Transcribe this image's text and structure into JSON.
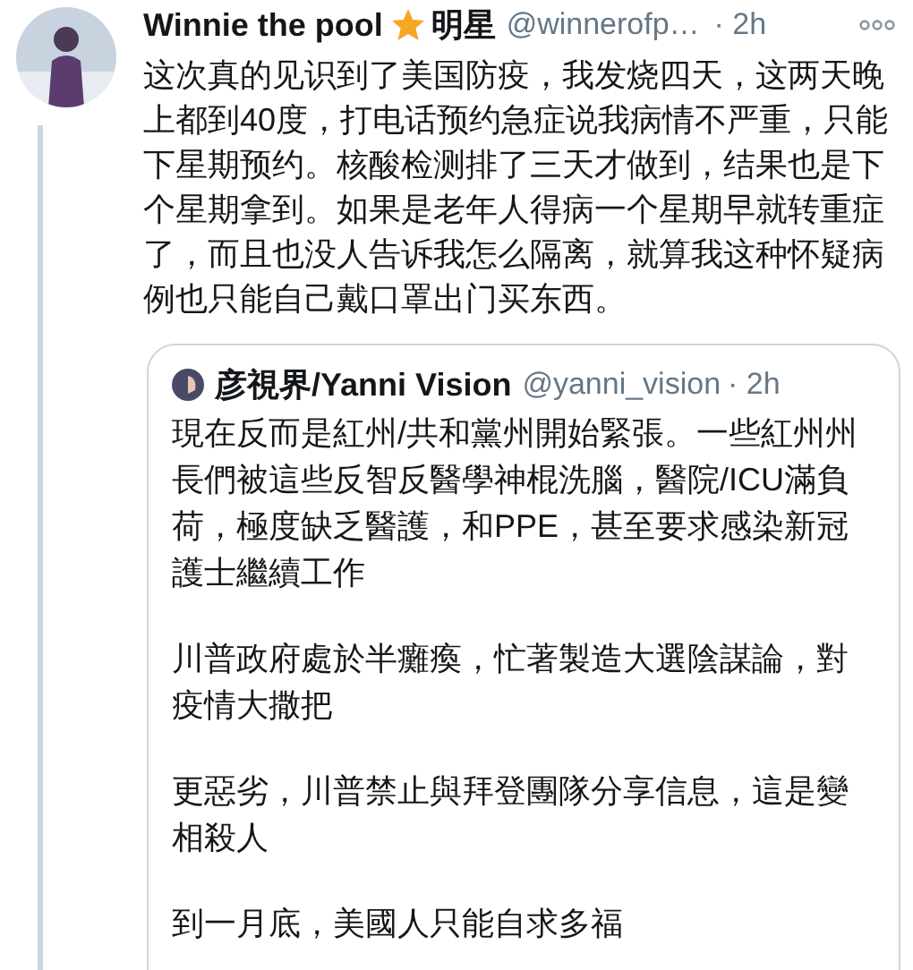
{
  "tweet": {
    "author": {
      "name": "Winnie the pool",
      "badge_label": "明星",
      "handle": "@winnerofp…",
      "time": "· 2h"
    },
    "text": "这次真的见识到了美国防疫，我发烧四天，这两天晚上都到40度，打电话预约急症说我病情不严重，只能下星期预约。核酸检测排了三天才做到，结果也是下个星期拿到。如果是老年人得病一个星期早就转重症了，而且也没人告诉我怎么隔离，就算我这种怀疑病例也只能自己戴口罩出门买东西。",
    "quoted_tweet": {
      "author": {
        "name": "彦視界/Yanni Vision",
        "handle": "@yanni_vision",
        "time": "· 2h"
      },
      "paragraphs": [
        "現在反而是紅州/共和黨州開始緊張。一些紅州州長們被這些反智反醫學神棍洗腦，醫院/ICU滿負荷，極度缺乏醫護，和PPE，甚至要求感染新冠護士繼續工作",
        "川普政府處於半癱瘓，忙著製造大選陰謀論，對疫情大撒把",
        "更惡劣，川普禁止與拜登團隊分享信息，這是變相殺人",
        "到一月底，美國人只能自求多福"
      ]
    }
  }
}
